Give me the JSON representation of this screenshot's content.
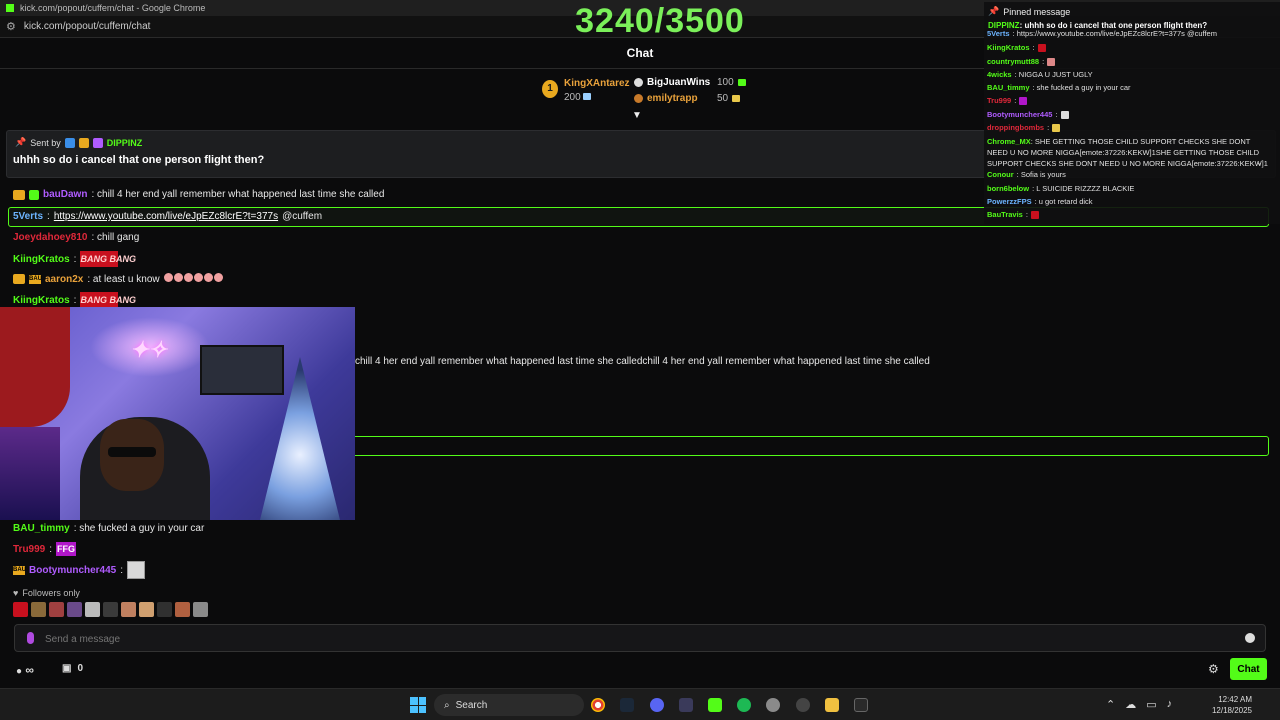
{
  "window": {
    "title": "kick.com/popout/cuffem/chat - Google Chrome",
    "url": "kick.com/popout/cuffem/chat"
  },
  "goal": {
    "text": "3240/3500"
  },
  "chat_title": "Chat",
  "leaderboard": {
    "first": {
      "rank": "1",
      "name": "KingXAntarez",
      "value": "200"
    },
    "second": {
      "name": "BigJuanWins",
      "value": "100"
    },
    "third": {
      "name": "emilytrapp",
      "value": "50"
    }
  },
  "pinned": {
    "sent_by_label": "Sent by",
    "sender": "DIPPINZ",
    "text": "uhhh so do i cancel that one person flight then?"
  },
  "messages": [
    {
      "user": "bauDawn",
      "color": "#b05cff",
      "text": ": chill 4 her end yall remember what happened last time she called"
    },
    {
      "user": "5Verts",
      "color": "#6cb4ff",
      "text": ": ",
      "link": "https://www.youtube.com/live/eJpEZc8lcrE?t=377s",
      "after": " @cuffem"
    },
    {
      "user": "Joeydahoey810",
      "color": "#e0283a",
      "text": ": chill gang"
    },
    {
      "user": "KiingKratos",
      "color": "#53fc18",
      "text": ":",
      "emote": "BANG BANG"
    },
    {
      "user": "aaron2x",
      "color": "#e9a23b",
      "text": ": at least u know"
    },
    {
      "user": "KiingKratos",
      "color": "#53fc18",
      "text": ":",
      "emote": "BANG BANG"
    },
    {
      "user": "BAU_timmy",
      "color": "#53fc18",
      "text": ": she fucked a guy in your car"
    },
    {
      "user": "Tru999",
      "color": "#e0283a",
      "text": ":",
      "emote": "FFG"
    },
    {
      "user": "Bootymuncher445",
      "color": "#b05cff",
      "text": ":"
    }
  ],
  "long_message": "chill 4 her end yall remember what happened last time she calledchill 4 her end yall remember what happened last time she called",
  "followers_only": "Followers only",
  "input": {
    "placeholder": "Send a message"
  },
  "bottom": {
    "infinity": "∞",
    "points": "0",
    "chat_button": "Chat"
  },
  "taskbar": {
    "search": "Search",
    "time": "12:42 AM",
    "date": "12/18/2025"
  },
  "overlay": {
    "header": "Pinned message",
    "pinned_user": "DIPPINZ",
    "pinned_text": ": uhhh so do i cancel that one person flight then?",
    "lines": [
      {
        "user": "5Verts",
        "color": "#6cb4ff",
        "text": ": https://www.youtube.com/live/eJpEZc8lcrE?t=377s @cuffem"
      },
      {
        "user": "KiingKratos",
        "color": "#53fc18",
        "text": ":"
      },
      {
        "user": "countrymutt88",
        "color": "#53fc18",
        "text": ":"
      },
      {
        "user": "4wicks",
        "color": "#53fc18",
        "text": ": NIGGA U JUST UGLY"
      },
      {
        "user": "BAU_timmy",
        "color": "#53fc18",
        "text": ": she fucked a guy in your car"
      },
      {
        "user": "Tru999",
        "color": "#e0283a",
        "text": ":"
      },
      {
        "user": "Bootymuncher445",
        "color": "#b05cff",
        "text": ":"
      },
      {
        "user": "droppingbombs",
        "color": "#e0283a",
        "text": ":"
      }
    ],
    "wrap_user": "Chrome_MX",
    "wrap_text": ": SHE GETTING THOSE CHILD SUPPORT CHECKS SHE DONT NEED U NO MORE NIGGA[emote:37226:KEKW]1SHE GETTING THOSE CHILD SUPPORT CHECKS SHE DONT NEED U NO MORE NIGGA[emote:37226:KEKW]1",
    "lines2": [
      {
        "user": "Conour",
        "color": "#53fc18",
        "text": ": Sofia is yours"
      },
      {
        "user": "born6below",
        "color": "#53fc18",
        "text": ": L SUICIDE RIZZZZ BLACKIE"
      },
      {
        "user": "PowerzzFPS",
        "color": "#6cb4ff",
        "text": ": u got retard dick"
      },
      {
        "user": "BauTravis",
        "color": "#53fc18",
        "text": ":"
      }
    ]
  }
}
